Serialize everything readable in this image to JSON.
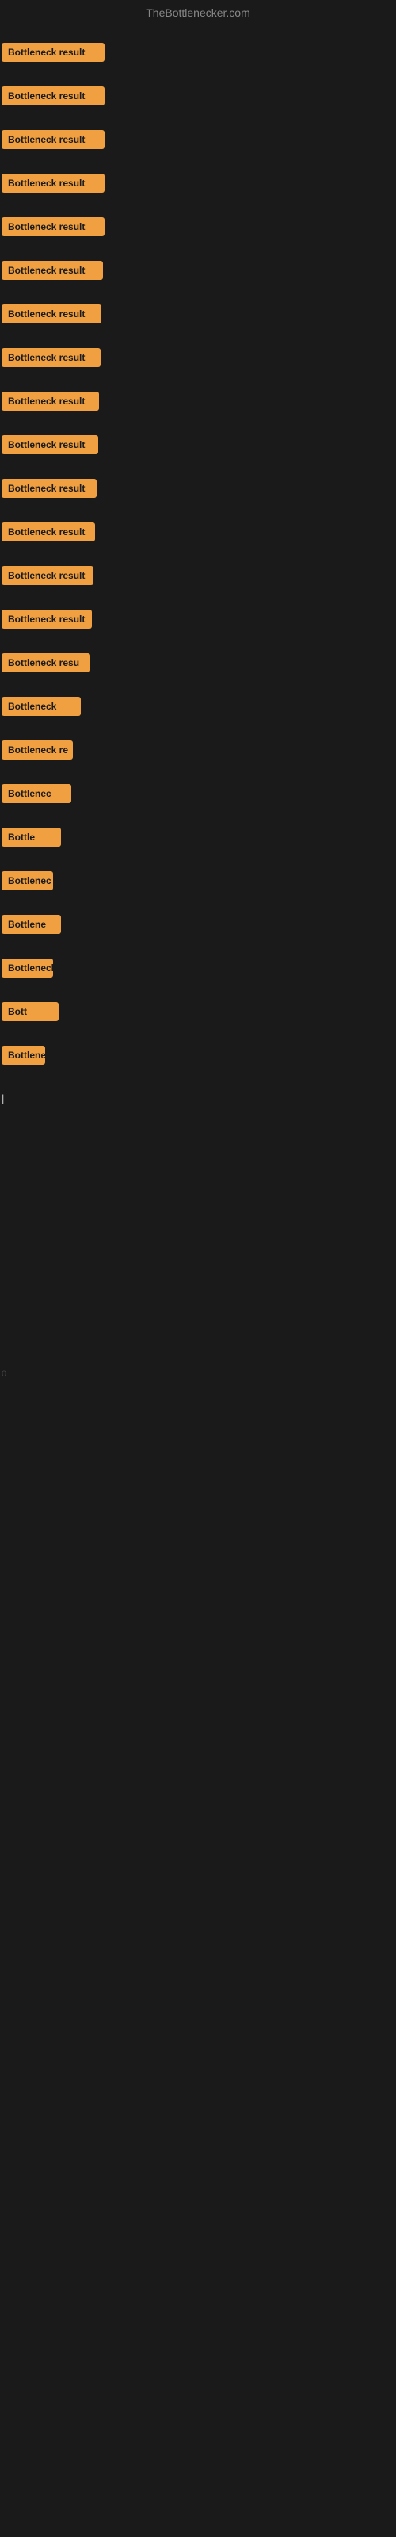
{
  "site": {
    "title": "TheBottlenecker.com"
  },
  "badge_label": "Bottleneck result",
  "rows": [
    {
      "id": 1,
      "label": "Bottleneck result",
      "width": 130
    },
    {
      "id": 2,
      "label": "Bottleneck result",
      "width": 130
    },
    {
      "id": 3,
      "label": "Bottleneck result",
      "width": 130
    },
    {
      "id": 4,
      "label": "Bottleneck result",
      "width": 130
    },
    {
      "id": 5,
      "label": "Bottleneck result",
      "width": 130
    },
    {
      "id": 6,
      "label": "Bottleneck result",
      "width": 128
    },
    {
      "id": 7,
      "label": "Bottleneck result",
      "width": 126
    },
    {
      "id": 8,
      "label": "Bottleneck result",
      "width": 125
    },
    {
      "id": 9,
      "label": "Bottleneck result",
      "width": 123
    },
    {
      "id": 10,
      "label": "Bottleneck result",
      "width": 122
    },
    {
      "id": 11,
      "label": "Bottleneck result",
      "width": 120
    },
    {
      "id": 12,
      "label": "Bottleneck result",
      "width": 118
    },
    {
      "id": 13,
      "label": "Bottleneck result",
      "width": 116
    },
    {
      "id": 14,
      "label": "Bottleneck result",
      "width": 114
    },
    {
      "id": 15,
      "label": "Bottleneck resu",
      "width": 112
    },
    {
      "id": 16,
      "label": "Bottleneck",
      "width": 100
    },
    {
      "id": 17,
      "label": "Bottleneck re",
      "width": 95
    },
    {
      "id": 18,
      "label": "Bottlenec",
      "width": 80
    },
    {
      "id": 19,
      "label": "Bottle",
      "width": 60
    },
    {
      "id": 20,
      "label": "Bottlenec",
      "width": 75
    },
    {
      "id": 21,
      "label": "Bottlene",
      "width": 68
    },
    {
      "id": 22,
      "label": "Bottleneck",
      "width": 80
    },
    {
      "id": 23,
      "label": "Bott",
      "width": 52
    },
    {
      "id": 24,
      "label": "Bottlene",
      "width": 68
    }
  ],
  "sparse_items": [
    {
      "id": 1,
      "char": "|"
    },
    {
      "id": 2,
      "char": ""
    },
    {
      "id": 3,
      "char": ""
    },
    {
      "id": 4,
      "char": "0"
    },
    {
      "id": 5,
      "char": ""
    },
    {
      "id": 6,
      "char": ""
    },
    {
      "id": 7,
      "char": ""
    },
    {
      "id": 8,
      "char": ""
    },
    {
      "id": 9,
      "char": ""
    },
    {
      "id": 10,
      "char": ""
    }
  ],
  "colors": {
    "badge_bg": "#f0a040",
    "badge_text": "#1a1a1a",
    "background": "#1a1a1a",
    "title_color": "#888888"
  }
}
